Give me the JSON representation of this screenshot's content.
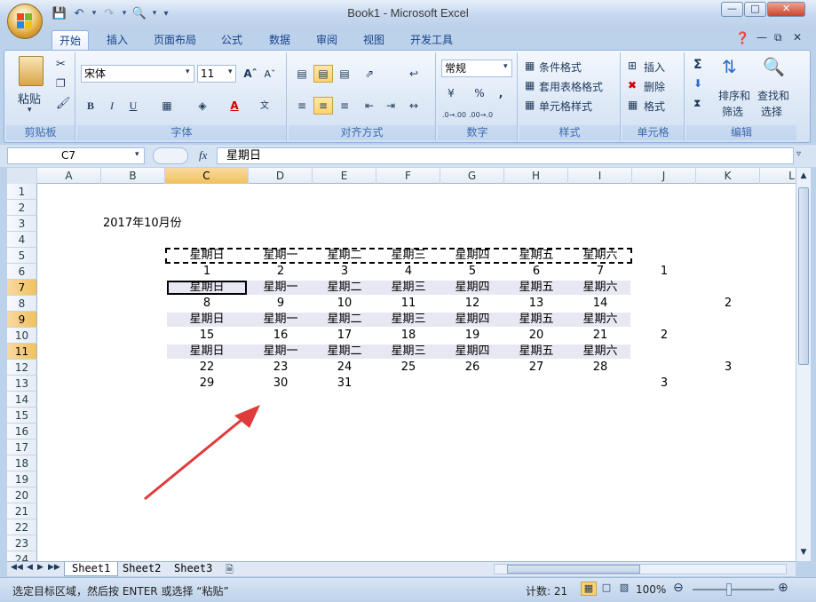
{
  "window": {
    "title": "Book1 - Microsoft Excel"
  },
  "tabs": [
    "开始",
    "插入",
    "页面布局",
    "公式",
    "数据",
    "审阅",
    "视图",
    "开发工具"
  ],
  "ribbon": {
    "clipboard": {
      "paste": "粘贴",
      "label": "剪贴板"
    },
    "font": {
      "name": "宋体",
      "size": "11",
      "bold": "B",
      "italic": "I",
      "underline": "U",
      "label": "字体"
    },
    "alignment": {
      "label": "对齐方式"
    },
    "number": {
      "format": "常规",
      "percent": "%",
      "comma": ",",
      "inc_decimal": ".0→.00",
      "dec_decimal": ".00→.0",
      "label": "数字"
    },
    "styles": {
      "conditional": "条件格式",
      "table": "套用表格格式",
      "cell": "单元格样式",
      "label": "样式"
    },
    "cells": {
      "insert": "插入",
      "delete": "删除",
      "format": "格式",
      "label": "单元格"
    },
    "editing": {
      "sum": "Σ",
      "sort": "排序和",
      "sort2": "筛选",
      "find": "查找和",
      "find2": "选择",
      "label": "编辑"
    }
  },
  "formula_bar": {
    "name_box": "C7",
    "fx": "fx",
    "content": "星期日"
  },
  "columns": [
    "A",
    "B",
    "C",
    "D",
    "E",
    "F",
    "G",
    "H",
    "I",
    "J",
    "K",
    "L"
  ],
  "selected_column": "C",
  "rows": [
    "1",
    "2",
    "3",
    "4",
    "5",
    "6",
    "7",
    "8",
    "9",
    "10",
    "11",
    "12",
    "13",
    "14",
    "15",
    "16",
    "17",
    "18",
    "19",
    "20",
    "21",
    "22",
    "23",
    "24"
  ],
  "selected_rows": [
    "7",
    "9",
    "11"
  ],
  "sheet": {
    "title_cell": "2017年10月份",
    "weekdays": [
      "星期日",
      "星期一",
      "星期二",
      "星期三",
      "星期四",
      "星期五",
      "星期六"
    ],
    "weeks": [
      [
        "1",
        "2",
        "3",
        "4",
        "5",
        "6",
        "7"
      ],
      [
        "8",
        "9",
        "10",
        "11",
        "12",
        "13",
        "14"
      ],
      [
        "15",
        "16",
        "17",
        "18",
        "19",
        "20",
        "21"
      ],
      [
        "22",
        "23",
        "24",
        "25",
        "26",
        "27",
        "28"
      ],
      [
        "29",
        "30",
        "31",
        "",
        "",
        "",
        ""
      ]
    ],
    "col_j": {
      "r6": "1",
      "r10": "2",
      "r13": "3"
    },
    "col_k": {
      "r8": "2",
      "r12": "3"
    }
  },
  "sheet_tabs": [
    "Sheet1",
    "Sheet2",
    "Sheet3"
  ],
  "status": {
    "message": "选定目标区域，然后按 ENTER 或选择 “粘贴”",
    "count": "计数: 21",
    "zoom": "100%"
  },
  "colors": {
    "accent": "#15428b",
    "selection": "#f1c15f",
    "arrow": "#e03b3b"
  }
}
